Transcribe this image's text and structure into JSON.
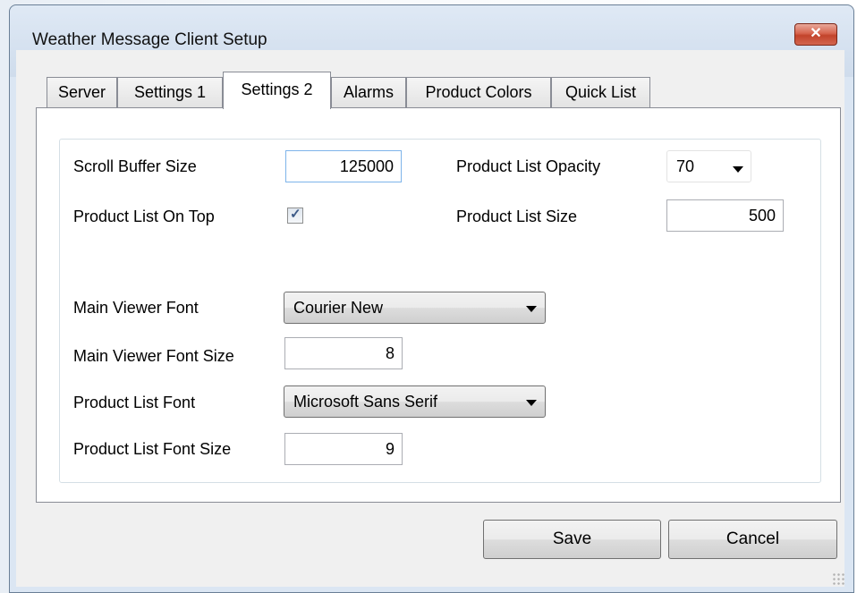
{
  "window": {
    "title": "Weather Message Client Setup",
    "close_glyph": "✕"
  },
  "tabs": [
    {
      "label": "Server"
    },
    {
      "label": "Settings 1"
    },
    {
      "label": "Settings 2"
    },
    {
      "label": "Alarms"
    },
    {
      "label": "Product Colors"
    },
    {
      "label": "Quick List"
    }
  ],
  "active_tab": "Settings 2",
  "settings": {
    "scroll_buffer_label": "Scroll Buffer Size",
    "scroll_buffer_value": "125000",
    "product_list_on_top_label": "Product List On Top",
    "product_list_on_top_checked": true,
    "product_list_opacity_label": "Product List Opacity",
    "product_list_opacity_value": "70",
    "product_list_size_label": "Product List Size",
    "product_list_size_value": "500",
    "main_viewer_font_label": "Main Viewer Font",
    "main_viewer_font_value": "Courier New",
    "main_viewer_font_size_label": "Main Viewer Font Size",
    "main_viewer_font_size_value": "8",
    "product_list_font_label": "Product List Font",
    "product_list_font_value": "Microsoft Sans Serif",
    "product_list_font_size_label": "Product List Font Size",
    "product_list_font_size_value": "9"
  },
  "buttons": {
    "save": "Save",
    "cancel": "Cancel"
  },
  "check_glyph": "✓"
}
